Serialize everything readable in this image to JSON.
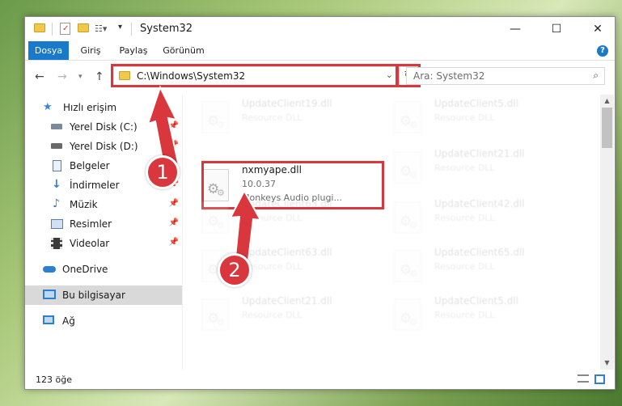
{
  "window": {
    "title": "System32",
    "controls": {
      "minimize": "—",
      "maximize": "☐",
      "close": "✕"
    }
  },
  "ribbon": {
    "tabs": [
      "Dosya",
      "Giriş",
      "Paylaş",
      "Görünüm"
    ],
    "help": "?"
  },
  "address": {
    "path": "C:\\Windows\\System32",
    "dropdown": "⌄",
    "refresh": "↻"
  },
  "search": {
    "placeholder": "Ara: System32"
  },
  "sidebar": {
    "items": [
      {
        "label": "Hızlı erişim",
        "icon": "star-icon",
        "pinned": false
      },
      {
        "label": "Yerel Disk (C:)",
        "icon": "drive-icon",
        "pinned": true
      },
      {
        "label": "Yerel Disk (D:)",
        "icon": "drive-icon",
        "pinned": true
      },
      {
        "label": "Belgeler",
        "icon": "document-icon",
        "pinned": true
      },
      {
        "label": "İndirmeler",
        "icon": "download-icon",
        "pinned": true
      },
      {
        "label": "Müzik",
        "icon": "music-icon",
        "pinned": true
      },
      {
        "label": "Resimler",
        "icon": "pictures-icon",
        "pinned": true
      },
      {
        "label": "Videolar",
        "icon": "video-icon",
        "pinned": true
      },
      {
        "label": "OneDrive",
        "icon": "cloud-icon",
        "pinned": false
      },
      {
        "label": "Bu bilgisayar",
        "icon": "computer-icon",
        "pinned": false
      },
      {
        "label": "Ağ",
        "icon": "network-icon",
        "pinned": false
      }
    ]
  },
  "files": {
    "highlighted": {
      "name": "nxmyape.dll",
      "version": "10.0.37",
      "description": "Monkeys Audio plugi..."
    },
    "left_column": [
      {
        "name": "UpdateClient19.dll",
        "type": "Resource DLL"
      },
      {
        "name": "UpdateClient63.dll",
        "type": "Resource DLL"
      },
      {
        "name": "UpdateClient63.dll",
        "type": "Resource DLL"
      },
      {
        "name": "UpdateClient21.dll",
        "type": "Resource DLL"
      }
    ],
    "right_column": [
      {
        "name": "UpdateClient5.dll",
        "type": "Resource DLL"
      },
      {
        "name": "UpdateClient21.dll",
        "type": "Resource DLL"
      },
      {
        "name": "UpdateClient42.dll",
        "type": "Resource DLL"
      },
      {
        "name": "UpdateClient65.dll",
        "type": "Resource DLL"
      },
      {
        "name": "UpdateClient5.dll",
        "type": "Resource DLL"
      }
    ]
  },
  "status": {
    "count": "123 öğe"
  },
  "annotations": {
    "step1": "1",
    "step2": "2",
    "color": "#d9363e"
  }
}
